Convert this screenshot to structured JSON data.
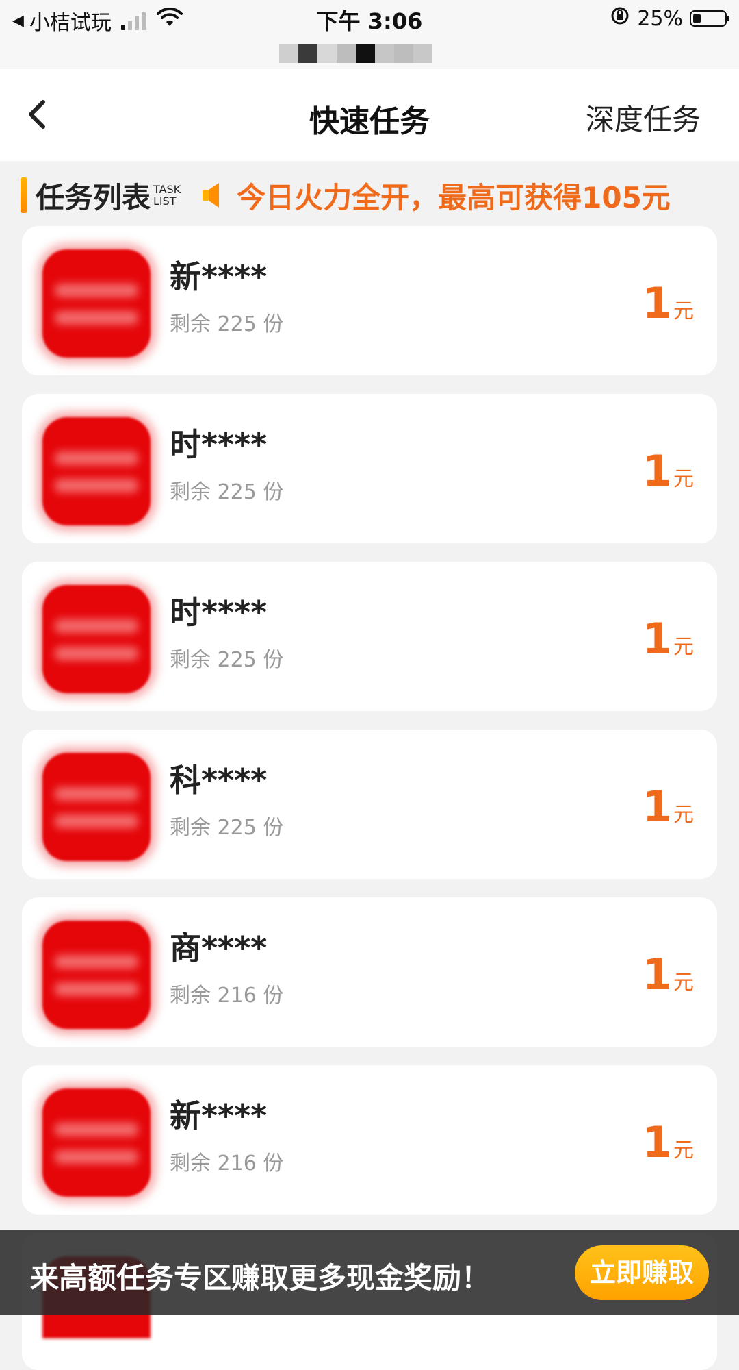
{
  "status_bar": {
    "back_app": "小桔试玩",
    "time": "下午 3:06",
    "battery_text": "25%",
    "battery_level": 0.25
  },
  "nav": {
    "title": "快速任务",
    "right_label": "深度任务"
  },
  "section": {
    "title": "任务列表",
    "subtitle_line1": "TASK",
    "subtitle_line2": "LIST",
    "promo": "今日火力全开，最高可获得105元"
  },
  "tasks": [
    {
      "name": "新****",
      "remaining": "剩余 225 份",
      "reward": "1",
      "unit": "元"
    },
    {
      "name": "时****",
      "remaining": "剩余 225 份",
      "reward": "1",
      "unit": "元"
    },
    {
      "name": "时****",
      "remaining": "剩余 225 份",
      "reward": "1",
      "unit": "元"
    },
    {
      "name": "科****",
      "remaining": "剩余 225 份",
      "reward": "1",
      "unit": "元"
    },
    {
      "name": "商****",
      "remaining": "剩余 216 份",
      "reward": "1",
      "unit": "元"
    },
    {
      "name": "新****",
      "remaining": "剩余 216 份",
      "reward": "1",
      "unit": "元"
    }
  ],
  "banner": {
    "text": "来高额任务专区赚取更多现金奖励！",
    "button": "立即赚取"
  },
  "colors": {
    "accent": "#f06a1c",
    "button": "#ffb000",
    "icon_red": "#e5060a"
  }
}
